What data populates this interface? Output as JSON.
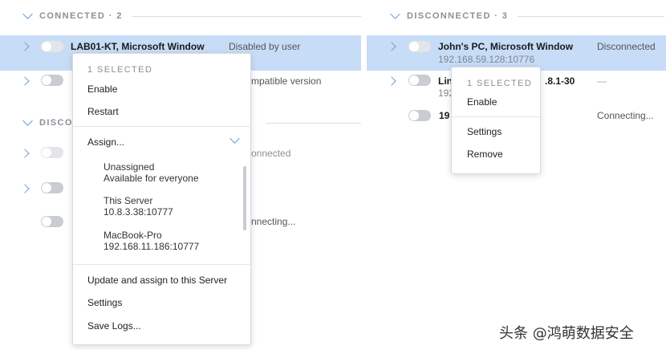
{
  "sections": {
    "connected_left": {
      "title": "CONNECTED · 2"
    },
    "disconnected_left": {
      "title": "DISCO"
    },
    "disconnected_right": {
      "title": "DISCONNECTED · 3"
    }
  },
  "left_rows": [
    {
      "name": "LAB01-KT, Microsoft Window",
      "status": "Disabled by user"
    },
    {
      "name": "",
      "status": "mpatible version"
    },
    {
      "name": "",
      "status": "onnected"
    },
    {
      "name": "",
      "status": ""
    },
    {
      "name": "",
      "status": "nnecting..."
    }
  ],
  "right_rows": [
    {
      "name": "John's PC, Microsoft Window",
      "address": "192.168.59.128:10776",
      "status": "Disconnected"
    },
    {
      "name": "Lin",
      "name_tail": ".8.1-30",
      "address": "192",
      "status": "—"
    },
    {
      "name": "19",
      "status": "Connecting..."
    }
  ],
  "left_menu": {
    "header": "1 SELECTED",
    "enable": "Enable",
    "restart": "Restart",
    "assign": "Assign...",
    "servers": [
      {
        "name": "Unassigned",
        "detail": "Available for everyone"
      },
      {
        "name": "This Server",
        "detail": "10.8.3.38:10777"
      },
      {
        "name": "MacBook-Pro",
        "detail": "192.168.11.186:10777"
      }
    ],
    "update_assign": "Update and assign to this Server",
    "settings": "Settings",
    "save_logs": "Save Logs..."
  },
  "right_menu": {
    "header": "1 SELECTED",
    "enable": "Enable",
    "settings": "Settings",
    "remove": "Remove"
  },
  "watermark": "头条 @鸿萌数据安全",
  "colors": {
    "accent": "#6b9dd6",
    "selected_row": "#c7dcf7"
  }
}
